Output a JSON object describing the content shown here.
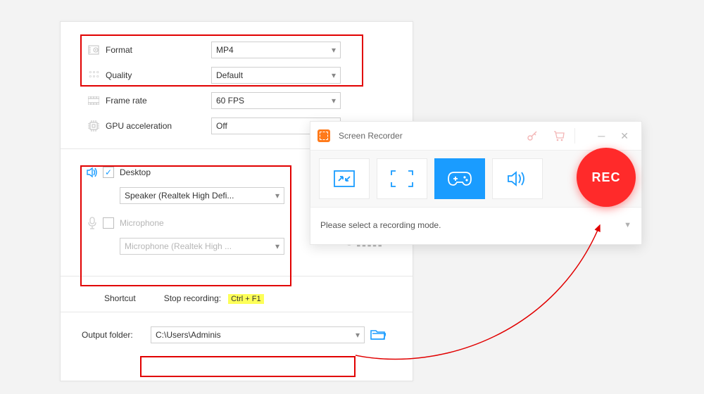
{
  "settings": {
    "format": {
      "label": "Format",
      "value": "MP4"
    },
    "quality": {
      "label": "Quality",
      "value": "Default"
    },
    "fps": {
      "label": "Frame rate",
      "value": "60 FPS"
    },
    "gpu": {
      "label": "GPU acceleration",
      "value": "Off"
    },
    "audio": {
      "desktop": {
        "label": "Desktop",
        "checked": true,
        "device": "Speaker (Realtek High Defi..."
      },
      "microphone": {
        "label": "Microphone",
        "checked": false,
        "device": "Microphone (Realtek High ..."
      }
    },
    "shortcut": {
      "title": "Shortcut",
      "stop_label": "Stop recording:",
      "stop_key": "Ctrl + F1"
    },
    "output": {
      "label": "Output folder:",
      "path": "C:\\Users\\Adminis"
    }
  },
  "recorder": {
    "title": "Screen Recorder",
    "status": "Please select a recording mode.",
    "rec_label": "REC",
    "modes": [
      "region",
      "fullscreen",
      "game",
      "audio"
    ]
  }
}
